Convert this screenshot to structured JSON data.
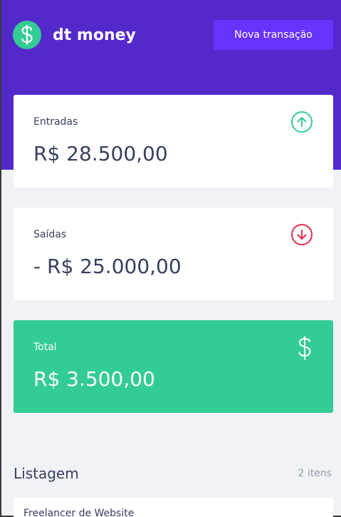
{
  "header": {
    "logo_text": "dt money",
    "new_transaction_label": "Nova transação"
  },
  "summary": {
    "income": {
      "label": "Entradas",
      "value": "R$ 28.500,00",
      "icon": "arrow-circle-up-icon"
    },
    "outcome": {
      "label": "Saídas",
      "value": "- R$ 25.000,00",
      "icon": "arrow-circle-down-icon"
    },
    "total": {
      "label": "Total",
      "value": "R$ 3.500,00",
      "icon": "dollar-sign-icon"
    }
  },
  "listing": {
    "title": "Listagem",
    "count": "2 itens",
    "items": [
      {
        "title": "Freelancer de Website"
      }
    ]
  },
  "colors": {
    "brand_purple": "#5429cc",
    "button_purple": "#6933ff",
    "green": "#33cc95",
    "red": "#e52e4d",
    "background": "#f0f2f5",
    "text": "#363f5f"
  }
}
